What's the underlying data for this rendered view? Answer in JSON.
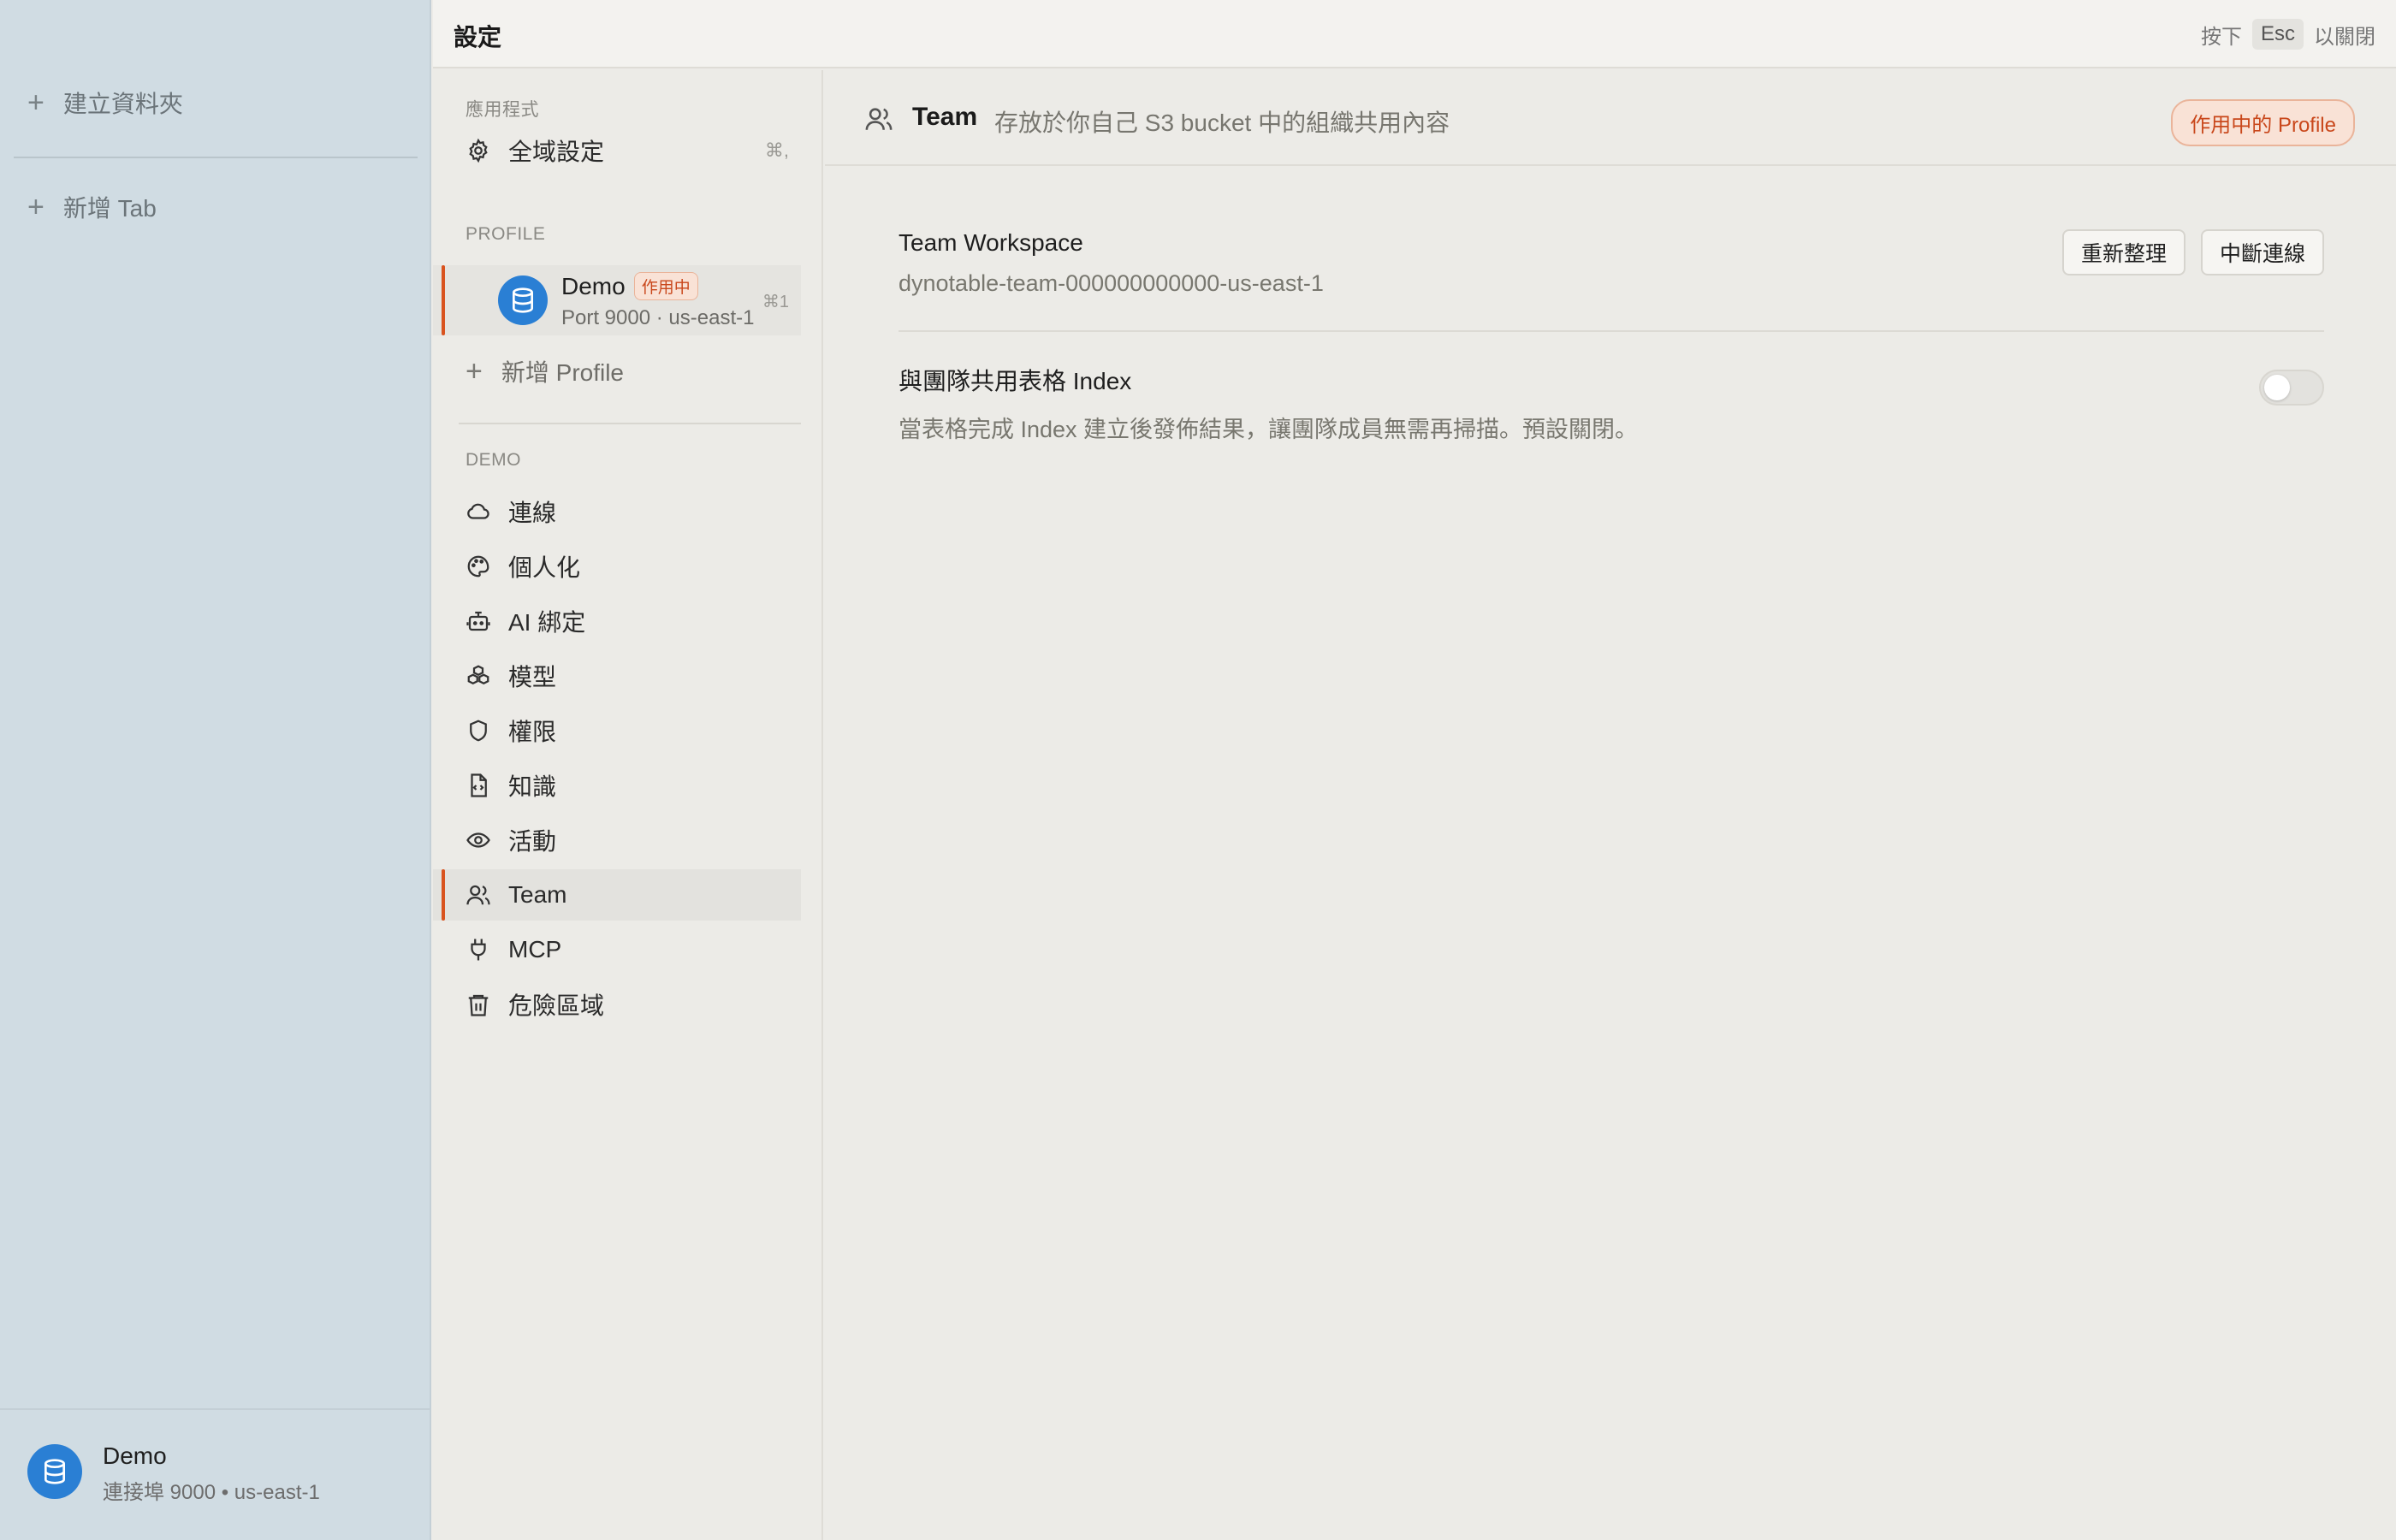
{
  "app_sidebar": {
    "create_folder": "建立資料夾",
    "new_tab": "新增 Tab",
    "footer": {
      "name": "Demo",
      "sub": "連接埠 9000 • us-east-1"
    }
  },
  "header": {
    "title": "設定",
    "hint_prefix": "按下",
    "hint_key": "Esc",
    "hint_suffix": "以關閉"
  },
  "nav": {
    "app_section": "應用程式",
    "global_settings": {
      "label": "全域設定",
      "shortcut": "⌘,"
    },
    "profile_section": "PROFILE",
    "profile": {
      "name": "Demo",
      "badge": "作用中",
      "sub": "Port 9000 · us-east-1",
      "shortcut": "⌘1"
    },
    "add_profile": "新增 Profile",
    "demo_section": "DEMO",
    "items": [
      {
        "label": "連線",
        "icon": "cloud-icon"
      },
      {
        "label": "個人化",
        "icon": "palette-icon"
      },
      {
        "label": "AI 綁定",
        "icon": "bot-icon"
      },
      {
        "label": "模型",
        "icon": "boxes-icon"
      },
      {
        "label": "權限",
        "icon": "shield-icon"
      },
      {
        "label": "知識",
        "icon": "file-code-icon"
      },
      {
        "label": "活動",
        "icon": "eye-icon"
      },
      {
        "label": "Team",
        "icon": "users-icon"
      },
      {
        "label": "MCP",
        "icon": "plug-icon"
      },
      {
        "label": "危險區域",
        "icon": "trash-icon"
      }
    ],
    "active_item": "Team"
  },
  "main": {
    "title": "Team",
    "description": "存放於你自己 S3 bucket 中的組織共用內容",
    "badge": "作用中的 Profile",
    "workspace": {
      "title": "Team Workspace",
      "value": "dynotable-team-000000000000-us-east-1",
      "refresh_label": "重新整理",
      "disconnect_label": "中斷連線"
    },
    "share_index": {
      "title": "與團隊共用表格 Index",
      "description": "當表格完成 Index 建立後發佈結果，讓團隊成員無需再掃描。預設關閉。",
      "enabled": false
    }
  },
  "colors": {
    "accent": "#d9531e",
    "avatar": "#2a7fd4",
    "sidebar_bg": "#d0dce3"
  }
}
